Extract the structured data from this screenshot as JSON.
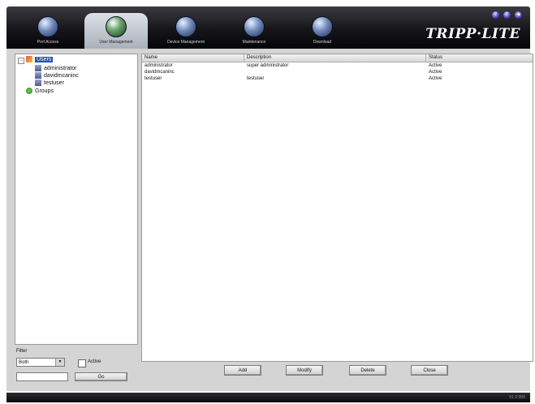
{
  "header": {
    "tabs": [
      {
        "label": "Port Access",
        "active": false
      },
      {
        "label": "User Management",
        "active": true
      },
      {
        "label": "Device Management",
        "active": false
      },
      {
        "label": "Maintenance",
        "active": false
      },
      {
        "label": "Download",
        "active": false
      }
    ],
    "logo_text": "TRIPP·LITE",
    "window_buttons": [
      "?",
      "?",
      "◀"
    ]
  },
  "tree": {
    "root": {
      "label": "Users",
      "expanded": true,
      "selected": true
    },
    "users": [
      "administrator",
      "davidmcaninc",
      "testuser"
    ],
    "groups": {
      "label": "Groups"
    }
  },
  "filter": {
    "label": "Filter",
    "select_value": "Both",
    "active_label": "Active",
    "active_checked": false,
    "input_value": "",
    "go_label": "Go"
  },
  "table": {
    "columns": [
      "Name",
      "Description",
      "Status"
    ],
    "rows": [
      [
        "administrator",
        "super administrator",
        "Active"
      ],
      [
        "davidmcaninc",
        "",
        "Active"
      ],
      [
        "testuser",
        "testuser",
        "Active"
      ]
    ]
  },
  "actions": {
    "add": "Add",
    "modify": "Modify",
    "delete": "Delete",
    "close": "Close"
  },
  "status": {
    "version": "V1.0.000"
  },
  "colors": {
    "selection": "#2a4fa8",
    "frame": "#d4d4d4",
    "topbar": "#16161a"
  }
}
